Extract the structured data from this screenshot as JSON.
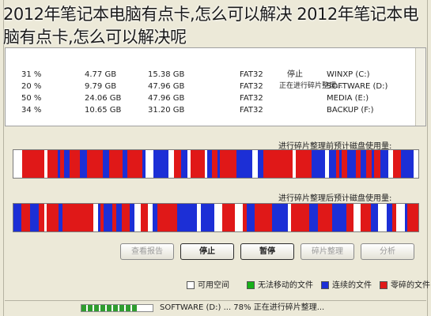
{
  "overlay_title": "2012年笔记本电脑有点卡,怎么可以解决 2012年笔记本电脑有点卡,怎么可以解决呢",
  "volumes": [
    {
      "name": "WINXP (C:)",
      "status": "停止",
      "fs": "FAT32",
      "capacity": "15.38 GB",
      "free": "4.77 GB",
      "pct": "31 %"
    },
    {
      "name": "SOFTWARE (D:)",
      "status": "正在进行碎片整理...",
      "fs": "FAT32",
      "capacity": "47.96 GB",
      "free": "9.79 GB",
      "pct": "20 %"
    },
    {
      "name": "MEDIA (E:)",
      "status": "",
      "fs": "FAT32",
      "capacity": "47.96 GB",
      "free": "24.06 GB",
      "pct": "50 %"
    },
    {
      "name": "BACKUP (F:)",
      "status": "",
      "fs": "FAT32",
      "capacity": "31.20 GB",
      "free": "10.65 GB",
      "pct": "34 %"
    }
  ],
  "before_label": "进行碎片整理前预计磁盘使用量:",
  "after_label": "进行碎片整理后预计磁盘使用量:",
  "buttons": {
    "view_report": "查看报告",
    "stop": "停止",
    "pause": "暂停",
    "defrag": "碎片整理",
    "analyze": "分析"
  },
  "legend": {
    "fragmented": "零碎的文件",
    "contiguous": "连续的文件",
    "unmovable": "无法移动的文件",
    "free": "可用空间"
  },
  "colors": {
    "fragmented": "#e01818",
    "contiguous": "#1c2fd6",
    "unmovable": "#18b018",
    "free": "#ffffff"
  },
  "status_text": "SOFTWARE (D:) ... 78%  正在进行碎片整理...",
  "progress_fraction": 0.78
}
